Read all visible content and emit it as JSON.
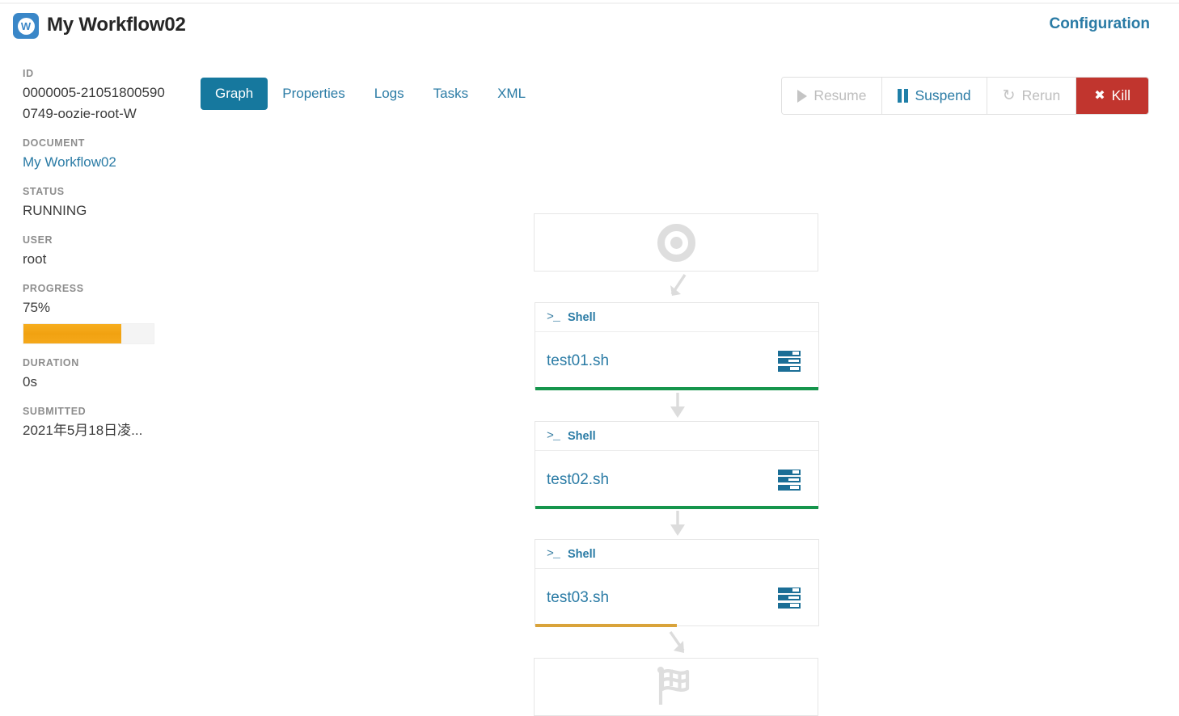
{
  "header": {
    "logo_icon": "workflow-w-icon",
    "title": "My Workflow02",
    "configuration_label": "Configuration"
  },
  "sidebar": {
    "fields": [
      {
        "label": "ID",
        "value": "0000005-210518005900749-oozie-root-W",
        "is_link": false
      },
      {
        "label": "DOCUMENT",
        "value": "My Workflow02",
        "is_link": true
      },
      {
        "label": "STATUS",
        "value": "RUNNING",
        "is_link": false
      },
      {
        "label": "USER",
        "value": "root",
        "is_link": false
      },
      {
        "label": "PROGRESS",
        "value": "75%",
        "is_link": false
      },
      {
        "label": "DURATION",
        "value": "0s",
        "is_link": false
      },
      {
        "label": "SUBMITTED",
        "value": "2021年5月18日凌...",
        "is_link": false
      }
    ],
    "progress": {
      "percent": 75,
      "fill_color": "#f2a314",
      "track_color": "#f4f4f4"
    }
  },
  "main": {
    "tabs": [
      {
        "label": "Graph",
        "active": true
      },
      {
        "label": "Properties",
        "active": false
      },
      {
        "label": "Logs",
        "active": false
      },
      {
        "label": "Tasks",
        "active": false
      },
      {
        "label": "XML",
        "active": false
      }
    ],
    "actions": [
      {
        "label": "Resume",
        "icon": "play-icon",
        "state": "disabled"
      },
      {
        "label": "Suspend",
        "icon": "pause-icon",
        "state": "enabled"
      },
      {
        "label": "Rerun",
        "icon": "refresh-icon",
        "state": "disabled"
      },
      {
        "label": "Kill",
        "icon": "close-x-icon",
        "state": "danger"
      }
    ]
  },
  "graph": {
    "start_node": {
      "icon": "start-target-icon"
    },
    "end_node": {
      "icon": "checkered-flag-icon"
    },
    "nodes": [
      {
        "kind": "Shell",
        "kind_icon": "terminal-prompt-icon",
        "name": "test01.sh",
        "action_icon": "logs-stack-icon",
        "status_color": "#15954c",
        "status_percent": 100
      },
      {
        "kind": "Shell",
        "kind_icon": "terminal-prompt-icon",
        "name": "test02.sh",
        "action_icon": "logs-stack-icon",
        "status_color": "#15954c",
        "status_percent": 100
      },
      {
        "kind": "Shell",
        "kind_icon": "terminal-prompt-icon",
        "name": "test03.sh",
        "action_icon": "logs-stack-icon",
        "status_color": "#d9a33a",
        "status_percent": 50
      }
    ],
    "edges": [
      {
        "direction": "down-left"
      },
      {
        "direction": "down"
      },
      {
        "direction": "down"
      },
      {
        "direction": "down-right"
      }
    ]
  },
  "colors": {
    "accent": "#2a7ba5",
    "tab_active_bg": "#16789e",
    "danger": "#c1352e",
    "success": "#15954c",
    "warning": "#d9a33a"
  }
}
